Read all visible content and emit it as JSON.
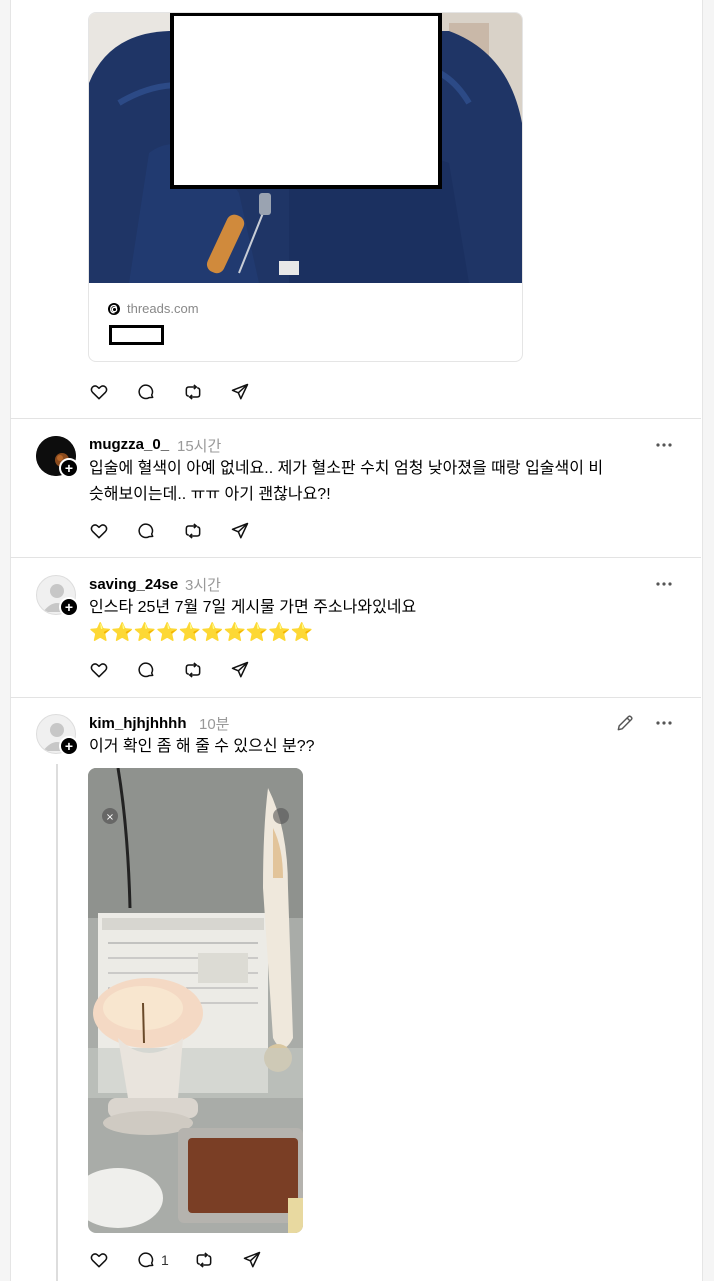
{
  "link_card": {
    "domain": "threads.com"
  },
  "post1_actions": {
    "like": "",
    "reply": "",
    "repost": "",
    "share": ""
  },
  "comments": [
    {
      "username": "mugzza_0_",
      "time": "15시간",
      "text_line1": "입술에 혈색이 아예 없네요.. 제가 혈소판 수치 엄청 낮아졌을 때랑 입술색이 비",
      "text_line2": "슷해보이는데.. ㅠㅠ 아기 괜찮나요?!"
    },
    {
      "username": "saving_24se",
      "time": "3시간",
      "text_line1": "인스타 25년 7월 7일 게시물 가면 주소나와있네요",
      "stars": "⭐⭐⭐⭐⭐⭐⭐⭐⭐⭐"
    },
    {
      "username": "kim_hjhjhhhh",
      "time": "10분",
      "text_line1": "이거 확인 좀 해 줄 수 있으신 분??",
      "reply_count": "1"
    }
  ],
  "colors": {
    "accent_dark": "#000000",
    "muted": "#999999",
    "jacket": "#1f3566",
    "divider": "#e3e3e3"
  }
}
